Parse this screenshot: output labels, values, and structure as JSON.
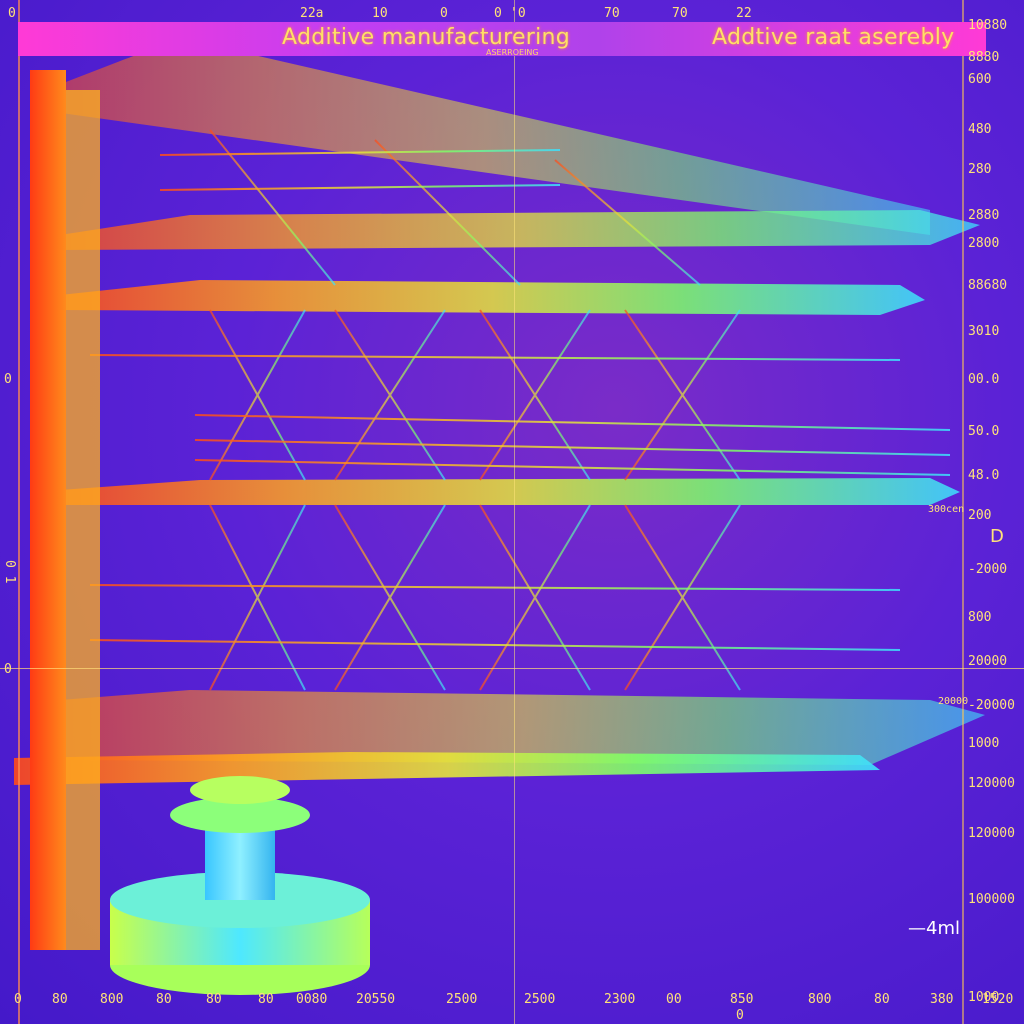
{
  "header": {
    "title_left": "Additive manufacturering",
    "title_right": "Addtive raat aserebly",
    "subtitle": "ASERROEING"
  },
  "ruler_top": [
    "0",
    "22a",
    "10",
    "0",
    "0",
    "'0",
    "70",
    "70",
    "22"
  ],
  "ruler_right": [
    "10880",
    "8880",
    "600",
    "480",
    "280",
    "2880",
    "2800",
    "88680",
    "3010",
    "00.0",
    "50.0",
    "48.0",
    "200",
    "-2000",
    "800",
    "20000",
    "-20000",
    "1000",
    "120000",
    "120000",
    "100000",
    "1000"
  ],
  "ruler_bottom": [
    "0",
    "80",
    "800",
    "80",
    "80",
    "80",
    "0080",
    "20550",
    "2500",
    "2500",
    "2300",
    "00",
    "850",
    "800",
    "80",
    "380",
    "1520",
    "0"
  ],
  "side_labels": {
    "left_zero": "0",
    "left_mid": "0 1",
    "left_low": "0",
    "right_mid": "300cen",
    "right_arrow": "20000",
    "d_marker": "D"
  },
  "scale_bar_label": "—4ml",
  "colors": {
    "background": "#5b22d6",
    "title_band": "#ff3ad6",
    "tick_text": "#ffe27a",
    "frame_hot": "#ff5a1f",
    "frame_warm": "#ffb51f",
    "frame_mid": "#d8ff3a",
    "frame_cool": "#39e6ff"
  }
}
